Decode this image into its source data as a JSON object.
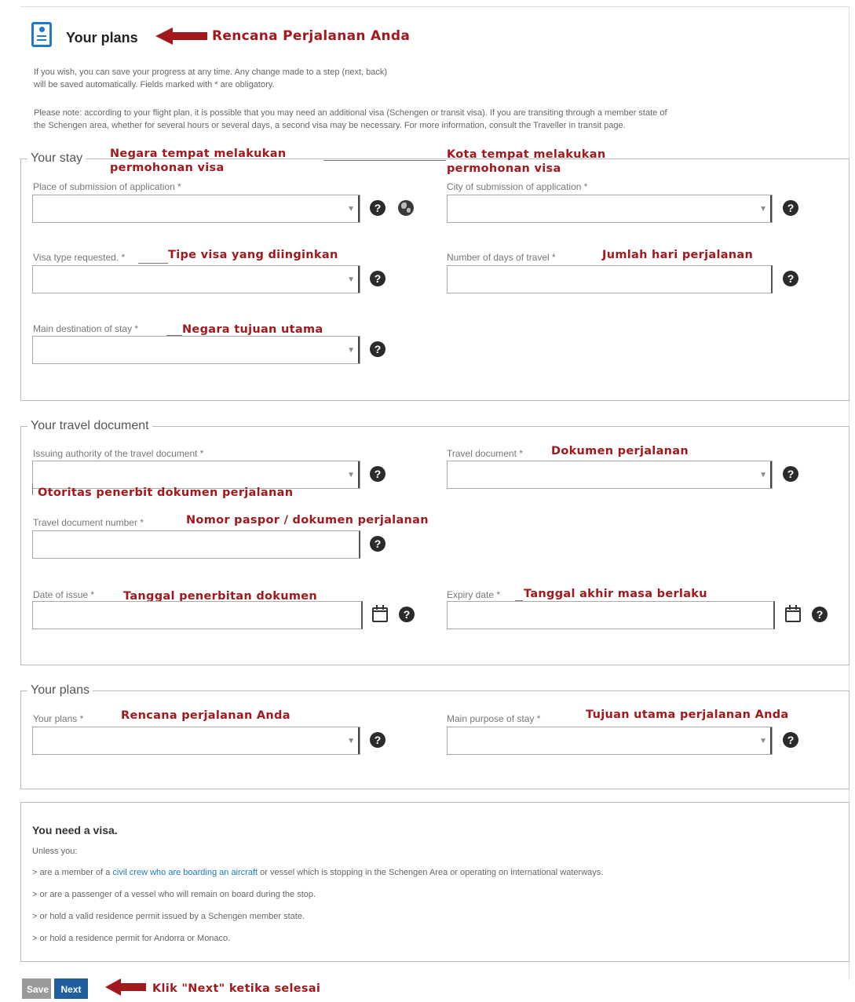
{
  "header": {
    "title": "Your plans",
    "annotation": "Rencana Perjalanan Anda"
  },
  "intro": {
    "line1": "If you wish, you can save your progress at any time. Any change made to a step (next, back)",
    "line2": "will be saved automatically. Fields marked with * are obligatory.",
    "note1": "Please note: according to your flight plan, it is possible that you may need an additional visa (Schengen or transit visa). If you are transiting through a member state of",
    "note2": "the Schengen area, whether for several hours or several days, a second visa may be necessary. For more information, consult the Traveller in transit page."
  },
  "stay": {
    "legend": "Your stay",
    "place_label": "Place of submission of application *",
    "place_ann1": "Negara tempat melakukan",
    "place_ann2": "permohonan visa",
    "city_label": "City of submission of application *",
    "city_ann1": "Kota tempat melakukan",
    "city_ann2": "permohonan visa",
    "visa_type_label": "Visa type requested. *",
    "visa_type_ann": "Tipe visa yang diinginkan",
    "days_label": "Number of days of travel *",
    "days_ann": "Jumlah hari perjalanan",
    "dest_label": "Main destination of stay *",
    "dest_ann": "Negara tujuan utama"
  },
  "doc": {
    "legend": "Your travel document",
    "authority_label": "Issuing authority of the travel document *",
    "authority_ann": "Otoritas penerbit dokumen perjalanan",
    "type_label": "Travel document *",
    "type_ann": "Dokumen perjalanan",
    "number_label": "Travel document number *",
    "number_ann": "Nomor paspor / dokumen perjalanan",
    "issue_label": "Date of issue *",
    "issue_ann": "Tanggal penerbitan dokumen",
    "expiry_label": "Expiry date *",
    "expiry_ann": "Tanggal akhir masa berlaku"
  },
  "plans": {
    "legend": "Your plans",
    "plans_label": "Your plans *",
    "plans_ann": "Rencana perjalanan Anda",
    "purpose_label": "Main purpose of stay *",
    "purpose_ann": "Tujuan utama perjalanan Anda"
  },
  "visa": {
    "title": "You need a visa.",
    "unless": "Unless you:",
    "l1_pre": "> are a member of a ",
    "l1_link": "civil crew who are boarding an aircraft",
    "l1_post": " or vessel which is stopping in the Schengen Area or operating on international waterways.",
    "l2": "> or are a passenger of a vessel who will remain on board during the stop.",
    "l3": "> or hold a valid residence permit issued by a Schengen member state.",
    "l4": "> or hold a residence permit for Andorra or Monaco."
  },
  "footer": {
    "save_label": "Save",
    "next_label": "Next",
    "next_ann": "Klik \"Next\" ketika selesai"
  },
  "icons": {
    "help": "?"
  },
  "colors": {
    "accent": "#1f78c8",
    "annotation": "#a3181d",
    "next_button": "#1f5f9e",
    "save_button": "#9a9a9a"
  }
}
